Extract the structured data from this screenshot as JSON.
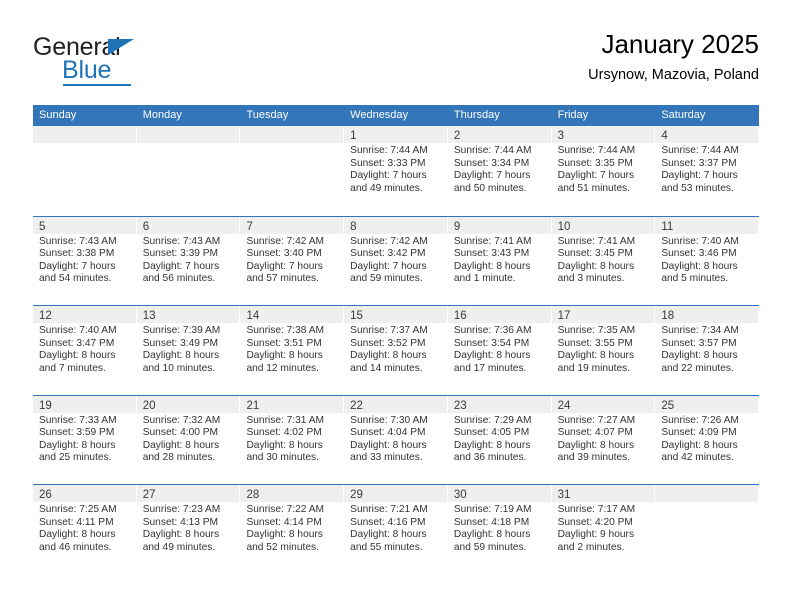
{
  "brand": {
    "name_part1": "General",
    "name_part2": "Blue",
    "accent_color": "#2173b8"
  },
  "header": {
    "title": "January 2025",
    "subtitle": "Ursynow, Mazovia, Poland"
  },
  "theme": {
    "header_blue": "#3275b8",
    "day_band_gray": "#efefef",
    "text_color": "#333333"
  },
  "weekday_headers": [
    "Sunday",
    "Monday",
    "Tuesday",
    "Wednesday",
    "Thursday",
    "Friday",
    "Saturday"
  ],
  "weeks": [
    [
      {
        "day": "",
        "empty": true
      },
      {
        "day": "",
        "empty": true
      },
      {
        "day": "",
        "empty": true
      },
      {
        "day": "1",
        "sunrise": "Sunrise: 7:44 AM",
        "sunset": "Sunset: 3:33 PM",
        "daylight1": "Daylight: 7 hours",
        "daylight2": "and 49 minutes."
      },
      {
        "day": "2",
        "sunrise": "Sunrise: 7:44 AM",
        "sunset": "Sunset: 3:34 PM",
        "daylight1": "Daylight: 7 hours",
        "daylight2": "and 50 minutes."
      },
      {
        "day": "3",
        "sunrise": "Sunrise: 7:44 AM",
        "sunset": "Sunset: 3:35 PM",
        "daylight1": "Daylight: 7 hours",
        "daylight2": "and 51 minutes."
      },
      {
        "day": "4",
        "sunrise": "Sunrise: 7:44 AM",
        "sunset": "Sunset: 3:37 PM",
        "daylight1": "Daylight: 7 hours",
        "daylight2": "and 53 minutes."
      }
    ],
    [
      {
        "day": "5",
        "sunrise": "Sunrise: 7:43 AM",
        "sunset": "Sunset: 3:38 PM",
        "daylight1": "Daylight: 7 hours",
        "daylight2": "and 54 minutes."
      },
      {
        "day": "6",
        "sunrise": "Sunrise: 7:43 AM",
        "sunset": "Sunset: 3:39 PM",
        "daylight1": "Daylight: 7 hours",
        "daylight2": "and 56 minutes."
      },
      {
        "day": "7",
        "sunrise": "Sunrise: 7:42 AM",
        "sunset": "Sunset: 3:40 PM",
        "daylight1": "Daylight: 7 hours",
        "daylight2": "and 57 minutes."
      },
      {
        "day": "8",
        "sunrise": "Sunrise: 7:42 AM",
        "sunset": "Sunset: 3:42 PM",
        "daylight1": "Daylight: 7 hours",
        "daylight2": "and 59 minutes."
      },
      {
        "day": "9",
        "sunrise": "Sunrise: 7:41 AM",
        "sunset": "Sunset: 3:43 PM",
        "daylight1": "Daylight: 8 hours",
        "daylight2": "and 1 minute."
      },
      {
        "day": "10",
        "sunrise": "Sunrise: 7:41 AM",
        "sunset": "Sunset: 3:45 PM",
        "daylight1": "Daylight: 8 hours",
        "daylight2": "and 3 minutes."
      },
      {
        "day": "11",
        "sunrise": "Sunrise: 7:40 AM",
        "sunset": "Sunset: 3:46 PM",
        "daylight1": "Daylight: 8 hours",
        "daylight2": "and 5 minutes."
      }
    ],
    [
      {
        "day": "12",
        "sunrise": "Sunrise: 7:40 AM",
        "sunset": "Sunset: 3:47 PM",
        "daylight1": "Daylight: 8 hours",
        "daylight2": "and 7 minutes."
      },
      {
        "day": "13",
        "sunrise": "Sunrise: 7:39 AM",
        "sunset": "Sunset: 3:49 PM",
        "daylight1": "Daylight: 8 hours",
        "daylight2": "and 10 minutes."
      },
      {
        "day": "14",
        "sunrise": "Sunrise: 7:38 AM",
        "sunset": "Sunset: 3:51 PM",
        "daylight1": "Daylight: 8 hours",
        "daylight2": "and 12 minutes."
      },
      {
        "day": "15",
        "sunrise": "Sunrise: 7:37 AM",
        "sunset": "Sunset: 3:52 PM",
        "daylight1": "Daylight: 8 hours",
        "daylight2": "and 14 minutes."
      },
      {
        "day": "16",
        "sunrise": "Sunrise: 7:36 AM",
        "sunset": "Sunset: 3:54 PM",
        "daylight1": "Daylight: 8 hours",
        "daylight2": "and 17 minutes."
      },
      {
        "day": "17",
        "sunrise": "Sunrise: 7:35 AM",
        "sunset": "Sunset: 3:55 PM",
        "daylight1": "Daylight: 8 hours",
        "daylight2": "and 19 minutes."
      },
      {
        "day": "18",
        "sunrise": "Sunrise: 7:34 AM",
        "sunset": "Sunset: 3:57 PM",
        "daylight1": "Daylight: 8 hours",
        "daylight2": "and 22 minutes."
      }
    ],
    [
      {
        "day": "19",
        "sunrise": "Sunrise: 7:33 AM",
        "sunset": "Sunset: 3:59 PM",
        "daylight1": "Daylight: 8 hours",
        "daylight2": "and 25 minutes."
      },
      {
        "day": "20",
        "sunrise": "Sunrise: 7:32 AM",
        "sunset": "Sunset: 4:00 PM",
        "daylight1": "Daylight: 8 hours",
        "daylight2": "and 28 minutes."
      },
      {
        "day": "21",
        "sunrise": "Sunrise: 7:31 AM",
        "sunset": "Sunset: 4:02 PM",
        "daylight1": "Daylight: 8 hours",
        "daylight2": "and 30 minutes."
      },
      {
        "day": "22",
        "sunrise": "Sunrise: 7:30 AM",
        "sunset": "Sunset: 4:04 PM",
        "daylight1": "Daylight: 8 hours",
        "daylight2": "and 33 minutes."
      },
      {
        "day": "23",
        "sunrise": "Sunrise: 7:29 AM",
        "sunset": "Sunset: 4:05 PM",
        "daylight1": "Daylight: 8 hours",
        "daylight2": "and 36 minutes."
      },
      {
        "day": "24",
        "sunrise": "Sunrise: 7:27 AM",
        "sunset": "Sunset: 4:07 PM",
        "daylight1": "Daylight: 8 hours",
        "daylight2": "and 39 minutes."
      },
      {
        "day": "25",
        "sunrise": "Sunrise: 7:26 AM",
        "sunset": "Sunset: 4:09 PM",
        "daylight1": "Daylight: 8 hours",
        "daylight2": "and 42 minutes."
      }
    ],
    [
      {
        "day": "26",
        "sunrise": "Sunrise: 7:25 AM",
        "sunset": "Sunset: 4:11 PM",
        "daylight1": "Daylight: 8 hours",
        "daylight2": "and 46 minutes."
      },
      {
        "day": "27",
        "sunrise": "Sunrise: 7:23 AM",
        "sunset": "Sunset: 4:13 PM",
        "daylight1": "Daylight: 8 hours",
        "daylight2": "and 49 minutes."
      },
      {
        "day": "28",
        "sunrise": "Sunrise: 7:22 AM",
        "sunset": "Sunset: 4:14 PM",
        "daylight1": "Daylight: 8 hours",
        "daylight2": "and 52 minutes."
      },
      {
        "day": "29",
        "sunrise": "Sunrise: 7:21 AM",
        "sunset": "Sunset: 4:16 PM",
        "daylight1": "Daylight: 8 hours",
        "daylight2": "and 55 minutes."
      },
      {
        "day": "30",
        "sunrise": "Sunrise: 7:19 AM",
        "sunset": "Sunset: 4:18 PM",
        "daylight1": "Daylight: 8 hours",
        "daylight2": "and 59 minutes."
      },
      {
        "day": "31",
        "sunrise": "Sunrise: 7:17 AM",
        "sunset": "Sunset: 4:20 PM",
        "daylight1": "Daylight: 9 hours",
        "daylight2": "and 2 minutes."
      },
      {
        "day": "",
        "empty": true
      }
    ]
  ]
}
